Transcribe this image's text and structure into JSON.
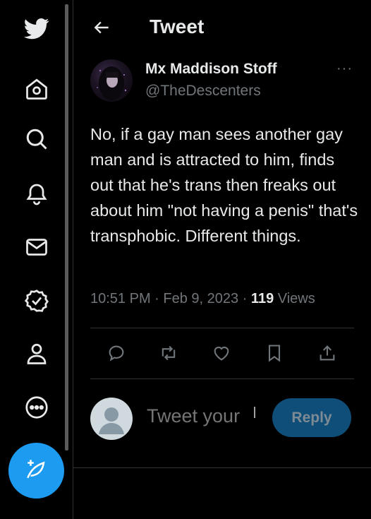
{
  "header": {
    "title": "Tweet"
  },
  "sidebar": {
    "items": [
      {
        "icon": "twitter-logo-icon"
      },
      {
        "icon": "home-icon"
      },
      {
        "icon": "search-icon"
      },
      {
        "icon": "bell-icon"
      },
      {
        "icon": "mail-icon"
      },
      {
        "icon": "verified-icon"
      },
      {
        "icon": "profile-icon"
      },
      {
        "icon": "more-circle-icon"
      }
    ],
    "compose_icon": "compose-feather-icon"
  },
  "tweet": {
    "author_name": "Mx Maddison Stoff",
    "author_handle": "@TheDescenters",
    "more": "···",
    "text": "No, if a gay man sees another gay man and is attracted to him, finds out that he's trans then freaks out about him \"not having a penis\" that's transphobic. Different things.",
    "time": "10:51 PM",
    "separator": " · ",
    "date": "Feb 9, 2023",
    "views_count": "119",
    "views_label": " Views"
  },
  "actions": [
    "reply-icon",
    "retweet-icon",
    "like-icon",
    "bookmark-icon",
    "share-icon"
  ],
  "reply_box": {
    "placeholder": "Tweet your",
    "button_label": "Reply"
  },
  "colors": {
    "accent": "#1d9bf0",
    "muted_text": "#71767b",
    "border": "#2f3336",
    "background": "#000000"
  }
}
